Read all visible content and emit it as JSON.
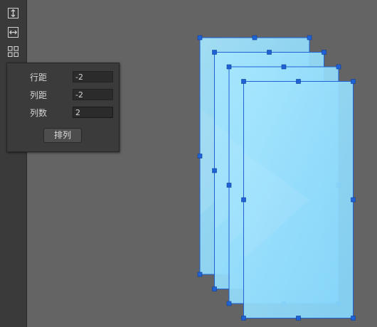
{
  "toolbar": {
    "tools": [
      {
        "icon": "vertical-arrange-icon"
      },
      {
        "icon": "horizontal-arrange-icon"
      },
      {
        "icon": "grid-arrange-icon"
      }
    ]
  },
  "arrange_panel": {
    "row_spacing": {
      "label": "行距",
      "value": "-2"
    },
    "column_spacing": {
      "label": "列距",
      "value": "-2"
    },
    "column_count": {
      "label": "列数",
      "value": "2"
    },
    "arrange_button_label": "排列"
  },
  "canvas": {
    "background_color": "#646464",
    "card_fill_color": "#8ddcfb",
    "selection_color": "#1e62d6",
    "card_count": 4
  }
}
